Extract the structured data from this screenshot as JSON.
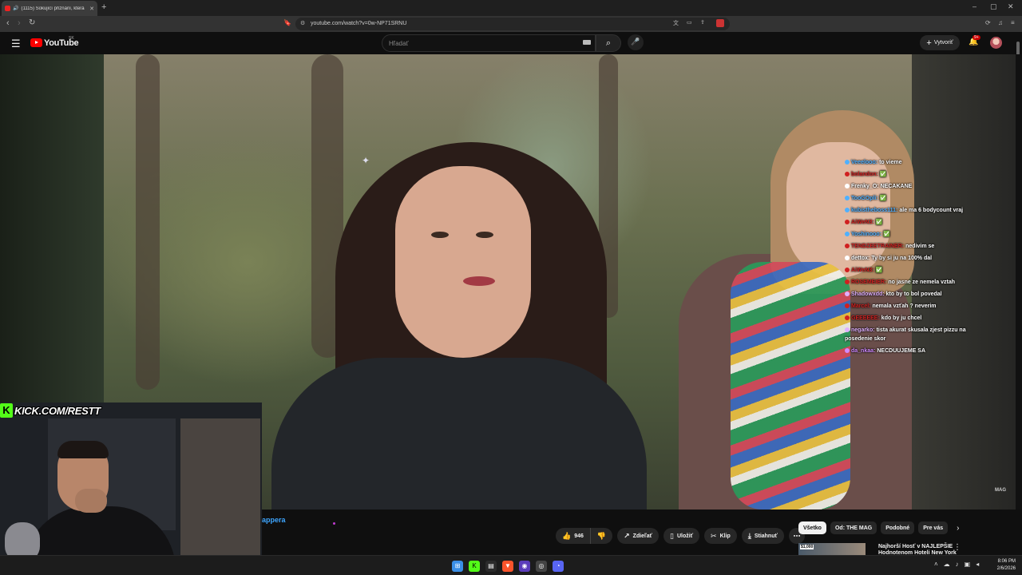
{
  "browser": {
    "tab_title": "(1115) Šokující přiznání, která",
    "new_tab": "+",
    "url": "youtube.com/watch?v=0w-NP71SRNU",
    "window_controls": [
      "–",
      "▢",
      "✕"
    ]
  },
  "youtube": {
    "logo_text": "YouTube",
    "country_code": "SK",
    "search_placeholder": "Hľadať",
    "create_label": "Vytvoriť",
    "notif_badge": "9+"
  },
  "video": {
    "watermark": "MAG"
  },
  "chat": [
    {
      "user": "Veeelooo:",
      "msg": "to vieme",
      "color": "#4fb0ff"
    },
    {
      "user": "bolandon:",
      "msg": "✅",
      "color": "#d02020"
    },
    {
      "user": "Frenky_O:",
      "msg": "NECAKANE",
      "color": "#ffffff"
    },
    {
      "user": "TooGOpli:",
      "msg": "✅",
      "color": "#4fb0ff"
    },
    {
      "user": "kubistheboss111:",
      "msg": "ale ma 6 bodycount vraj",
      "color": "#4fb0ff"
    },
    {
      "user": "AiWeN3:",
      "msg": "✅",
      "color": "#d02020"
    },
    {
      "user": "Yoshinooo:",
      "msg": "✅",
      "color": "#4fb0ff"
    },
    {
      "user": "TENDZEETRAINER:",
      "msg": "nedivim se",
      "color": "#d02020"
    },
    {
      "user": "dettox:",
      "msg": "Ty by si ju na 100% dal",
      "color": "#ffffff"
    },
    {
      "user": "AiWeN3:",
      "msg": "✅",
      "color": "#d02020"
    },
    {
      "user": "ROSEMEIER:",
      "msg": "no jasne ze nemela vztah",
      "color": "#d02020"
    },
    {
      "user": "Shadowxdd:",
      "msg": "kto by to bol povedal",
      "color": "#e0b0ff"
    },
    {
      "user": "Marcel:",
      "msg": "nemala vzťah ? neverim",
      "color": "#d02020"
    },
    {
      "user": "GEEEEEE:",
      "msg": "kdo by ju chcel",
      "color": "#d02020"
    },
    {
      "user": "negarko:",
      "msg": "tista akurat skusala zjest pizzu na posedenie skor",
      "color": "#e0b0ff"
    },
    {
      "user": "da_nkaa:",
      "msg": "NECDUUJEME SA",
      "color": "#d08aff"
    }
  ],
  "cam": {
    "kick_letter": "K",
    "kick_text": "KICK.COM/RESTT"
  },
  "below": {
    "title_fragment": "appera",
    "actions": {
      "like_count": "946",
      "share": "Zdieľať",
      "save": "Uložiť",
      "clip": "Klip",
      "download": "Stiahnuť"
    },
    "chips": [
      "Všetko",
      "Od: THE MAG",
      "Podobné",
      "Pre vás"
    ],
    "rec": {
      "price": "$1,000",
      "title": "Najhorší Hosť v NAJLEPŠIE Hodnotenom Hoteli New York"
    }
  },
  "taskbar": {
    "time": "8:06 PM",
    "date": "2/6/2026"
  }
}
